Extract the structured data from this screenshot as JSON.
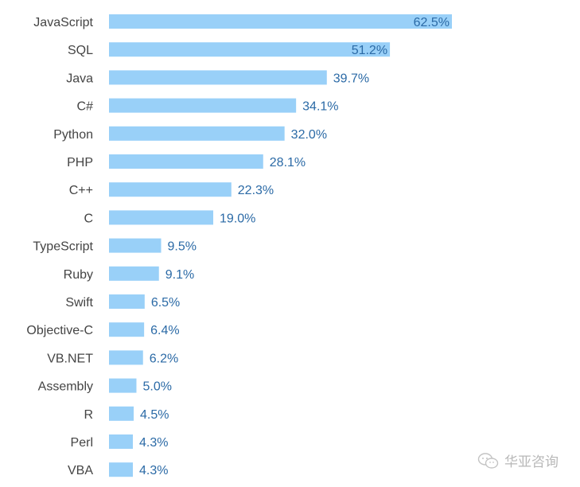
{
  "chart_data": {
    "type": "bar",
    "orientation": "horizontal",
    "title": "",
    "xlabel": "",
    "ylabel": "",
    "unit": "%",
    "categories": [
      "JavaScript",
      "SQL",
      "Java",
      "C#",
      "Python",
      "PHP",
      "C++",
      "C",
      "TypeScript",
      "Ruby",
      "Swift",
      "Objective-C",
      "VB.NET",
      "Assembly",
      "R",
      "Perl",
      "VBA"
    ],
    "values": [
      62.5,
      51.2,
      39.7,
      34.1,
      32.0,
      28.1,
      22.3,
      19.0,
      9.5,
      9.1,
      6.5,
      6.4,
      6.2,
      5.0,
      4.5,
      4.3,
      4.3
    ],
    "labels": [
      "62.5%",
      "51.2%",
      "39.7%",
      "34.1%",
      "32.0%",
      "28.1%",
      "22.3%",
      "19.0%",
      "9.5%",
      "9.1%",
      "6.5%",
      "6.4%",
      "6.2%",
      "5.0%",
      "4.5%",
      "4.3%",
      "4.3%"
    ],
    "xlim": [
      0,
      62.5
    ],
    "grid": false,
    "legend": "none",
    "colors": {
      "bar": "#99d0f8",
      "value_label": "#2b6aa6",
      "category_label": "#444444"
    }
  },
  "watermark": {
    "text": "华亚咨询",
    "icon": "wechat-icon"
  }
}
